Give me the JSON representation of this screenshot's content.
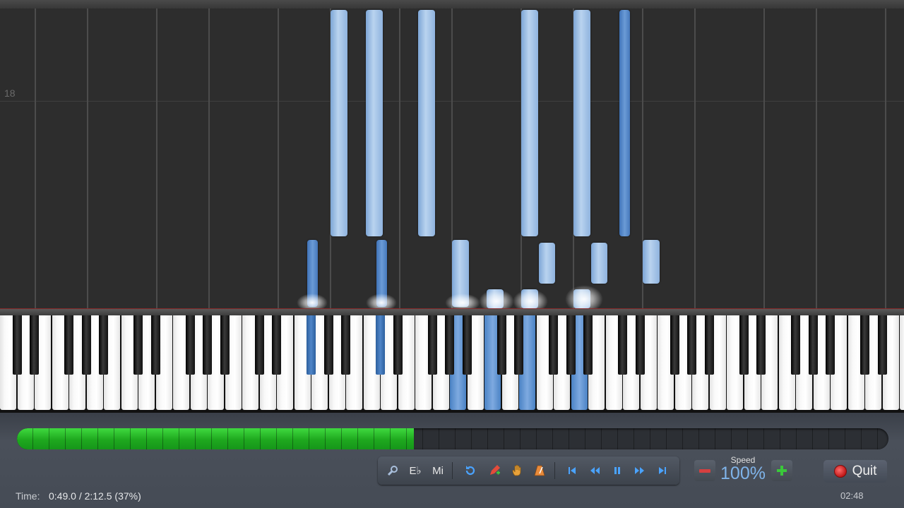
{
  "roll": {
    "measure_number": "18"
  },
  "toolbar": {
    "key_label": "E♭",
    "mode_label": "Mi"
  },
  "speed": {
    "label": "Speed",
    "value": "100%"
  },
  "quit_label": "Quit",
  "status": {
    "time_label": "Time:",
    "time_value": "0:49.0 / 2:12.5 (37%)",
    "clock": "02:48"
  },
  "progress": {
    "fraction": 0.37
  },
  "colors": {
    "note_light": "#a9c8ec",
    "note_dark": "#4a7fc1",
    "progress_green": "#2cc22c",
    "speed_value": "#7fb4ea"
  },
  "icons": [
    "zoom-icon",
    "undo-icon",
    "pencil-icon",
    "hand-icon",
    "metronome-icon",
    "skip-start-icon",
    "rewind-icon",
    "pause-icon",
    "fast-forward-icon",
    "skip-end-icon",
    "quit-icon"
  ]
}
